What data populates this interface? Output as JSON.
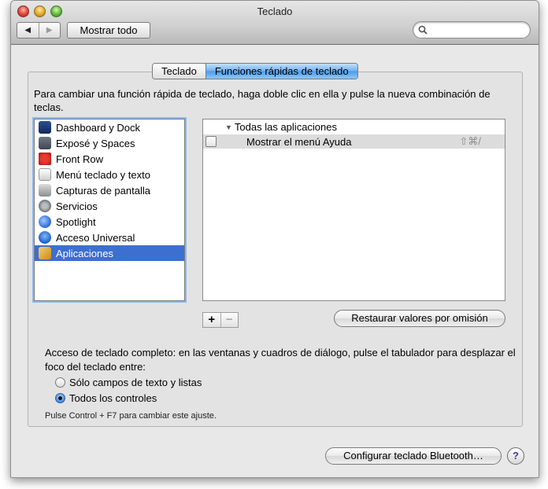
{
  "window": {
    "title": "Teclado",
    "nav_back_glyph": "◀",
    "nav_forward_glyph": "▶",
    "show_all_label": "Mostrar todo",
    "search_value": ""
  },
  "tabs": [
    {
      "label": "Teclado",
      "selected": false
    },
    {
      "label": "Funciones rápidas de teclado",
      "selected": true
    }
  ],
  "instructions": "Para cambiar una función rápida de teclado, haga doble clic en ella y pulse la nueva combinación de teclas.",
  "categories": [
    {
      "label": "Dashboard y Dock",
      "icon": "dashboard-icon"
    },
    {
      "label": "Exposé y Spaces",
      "icon": "expose-icon"
    },
    {
      "label": "Front Row",
      "icon": "front-row-icon"
    },
    {
      "label": "Menú teclado y texto",
      "icon": "keyboard-menu-icon"
    },
    {
      "label": "Capturas de pantalla",
      "icon": "screenshot-icon"
    },
    {
      "label": "Servicios",
      "icon": "services-gear-icon"
    },
    {
      "label": "Spotlight",
      "icon": "spotlight-icon"
    },
    {
      "label": "Acceso Universal",
      "icon": "universal-access-icon"
    },
    {
      "label": "Aplicaciones",
      "icon": "applications-icon",
      "selected": true
    }
  ],
  "shortcuts": {
    "group_label": "Todas las aplicaciones",
    "disclosure_glyph": "▼",
    "items": [
      {
        "label": "Mostrar el menú Ayuda",
        "keys": "⇧⌘/",
        "checked": false
      }
    ]
  },
  "controls": {
    "add_label": "+",
    "remove_label": "−",
    "restore_label": "Restaurar valores por omisión"
  },
  "full_keyboard_access": {
    "description": "Acceso de teclado completo: en las ventanas y cuadros de diálogo, pulse el tabulador para desplazar el foco del teclado entre:",
    "options": [
      {
        "label": "Sólo campos de texto y listas",
        "selected": false
      },
      {
        "label": "Todos los controles",
        "selected": true
      }
    ],
    "hint": "Pulse Control + F7 para cambiar este ajuste."
  },
  "footer": {
    "bluetooth_label": "Configurar teclado Bluetooth…",
    "help_label": "?"
  }
}
